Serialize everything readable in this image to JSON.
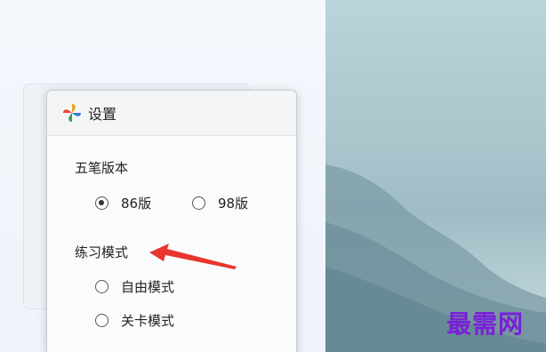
{
  "dialog": {
    "title": "设置",
    "title_icon": "pinwheel-logo-icon",
    "sections": {
      "version": {
        "label": "五笔版本",
        "options": [
          {
            "label": "86版",
            "checked": true
          },
          {
            "label": "98版",
            "checked": false
          }
        ]
      },
      "practice_mode": {
        "label": "练习模式",
        "options": [
          {
            "label": "自由模式",
            "checked": false
          },
          {
            "label": "关卡模式",
            "checked": false
          }
        ]
      }
    }
  },
  "annotation": {
    "arrow_color": "#e8352e"
  },
  "watermark": {
    "text": "最需网",
    "color": "#7a1fd8"
  }
}
